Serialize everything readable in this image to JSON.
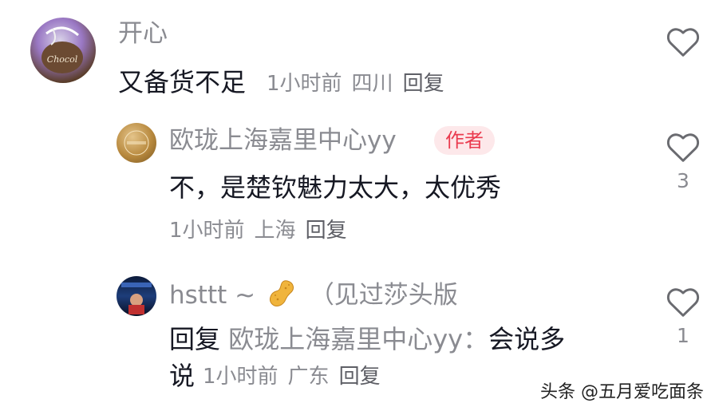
{
  "comments": [
    {
      "user": "开心",
      "text": "又备货不足",
      "time": "1小时前",
      "location": "四川",
      "reply_label": "回复",
      "likes": ""
    }
  ],
  "replies": [
    {
      "user": "欧珑上海嘉里中心yy",
      "badge": "作者",
      "text": "不，是楚钦魅力太大，太优秀",
      "time": "1小时前",
      "location": "上海",
      "reply_label": "回复",
      "likes": "3"
    },
    {
      "user": "hsttt ~",
      "user_suffix": "（见过莎头版",
      "reply_prefix": "回复",
      "reply_target": "欧珑上海嘉里中心yy：",
      "text_line1": "会说多",
      "text_line2": "说",
      "time": "1小时前",
      "location": "广东",
      "reply_label": "回复",
      "likes": "1"
    }
  ],
  "watermark": "头条 @五月爱吃面条",
  "colors": {
    "badge_bg": "#fde8ea",
    "badge_text": "#ea3b4f",
    "meta": "#8a8b91"
  },
  "icons": {
    "like": "heart-outline-icon",
    "emoji": "peanut-emoji-icon"
  }
}
